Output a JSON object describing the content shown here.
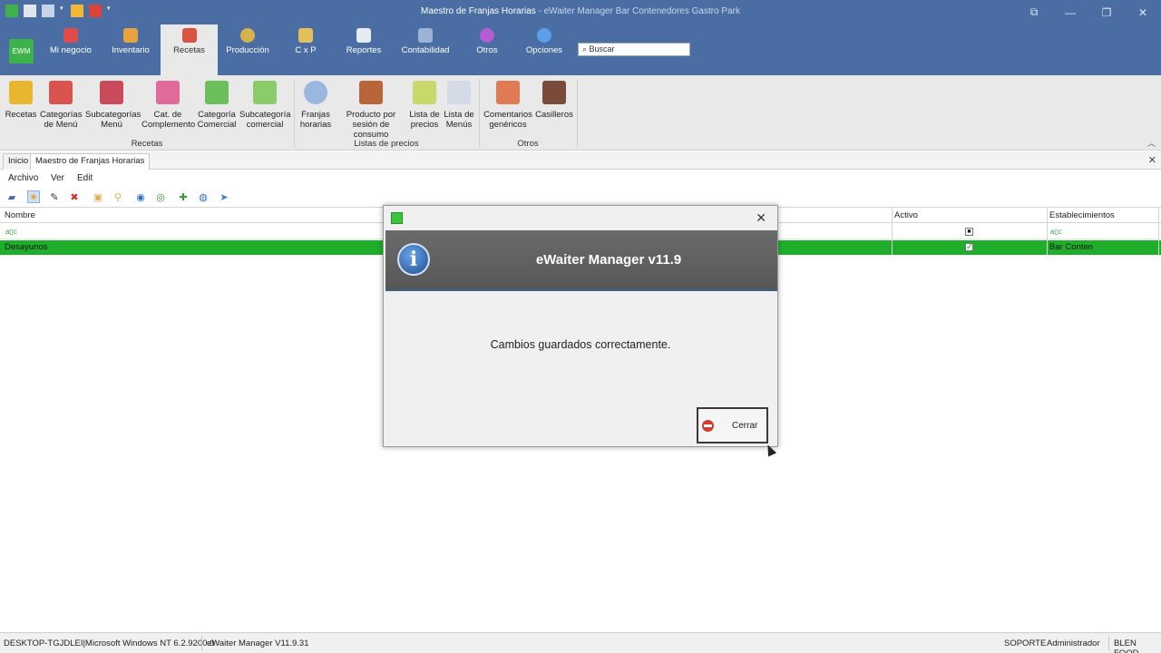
{
  "window": {
    "title": "Maestro de Franjas Horarias",
    "subtitle": " - eWaiter Manager Bar Contenedores Gastro Park",
    "controls": [
      "⧉",
      "—",
      "❐",
      "✕"
    ]
  },
  "search": {
    "placeholder": "Buscar"
  },
  "ribbon_tabs": [
    {
      "label": "Mi negocio"
    },
    {
      "label": "Inventario"
    },
    {
      "label": "Recetas"
    },
    {
      "label": "Producción"
    },
    {
      "label": "C x P"
    },
    {
      "label": "Reportes"
    },
    {
      "label": "Contabilidad"
    },
    {
      "label": "Otros"
    },
    {
      "label": "Opciones"
    }
  ],
  "ribbon_buttons": [
    {
      "line1": "Recetas",
      "line2": ""
    },
    {
      "line1": "Categorías",
      "line2": "de Menú"
    },
    {
      "line1": "Subcategorías",
      "line2": "Menú"
    },
    {
      "line1": "Cat. de",
      "line2": "Complemento"
    },
    {
      "line1": "Categoría",
      "line2": "Comercial"
    },
    {
      "line1": "Subcategoría",
      "line2": "comercial"
    },
    {
      "line1": "Franjas",
      "line2": "horarias"
    },
    {
      "line1": "Producto por",
      "line2": "sesión de consumo"
    },
    {
      "line1": "Lista de",
      "line2": "precios"
    },
    {
      "line1": "Lista de",
      "line2": "Menús"
    },
    {
      "line1": "Comentarios",
      "line2": "genéricos"
    },
    {
      "line1": "Casilleros",
      "line2": ""
    }
  ],
  "ribbon_groups": [
    "Recetas",
    "Listas de precios",
    "Otros"
  ],
  "doc_tabs": [
    "Inicio",
    "Maestro de Franjas Horarias"
  ],
  "menu": [
    "Archivo",
    "Ver",
    "Edit"
  ],
  "grid": {
    "columns": [
      "Nombre",
      "Activo",
      "Establecimientos"
    ],
    "rows": [
      {
        "nombre": "Desayunos",
        "activo": true,
        "establecimientos": "Bar Conten"
      }
    ]
  },
  "dialog": {
    "title": "eWaiter Manager v11.9",
    "message": "Cambios guardados correctamente.",
    "button": "Cerrar"
  },
  "status": {
    "machine": "DESKTOP-TGJDLEI|Microsoft Windows NT 6.2.9200.0",
    "version": "eWaiter Manager V11.9.31",
    "support": "SOPORTE",
    "user": "Administrador",
    "company": "BLEN FOOD"
  },
  "colors": {
    "titlebar": "#4a6ea3",
    "selected_row": "#1fae2b",
    "accent": "#3db24a"
  }
}
